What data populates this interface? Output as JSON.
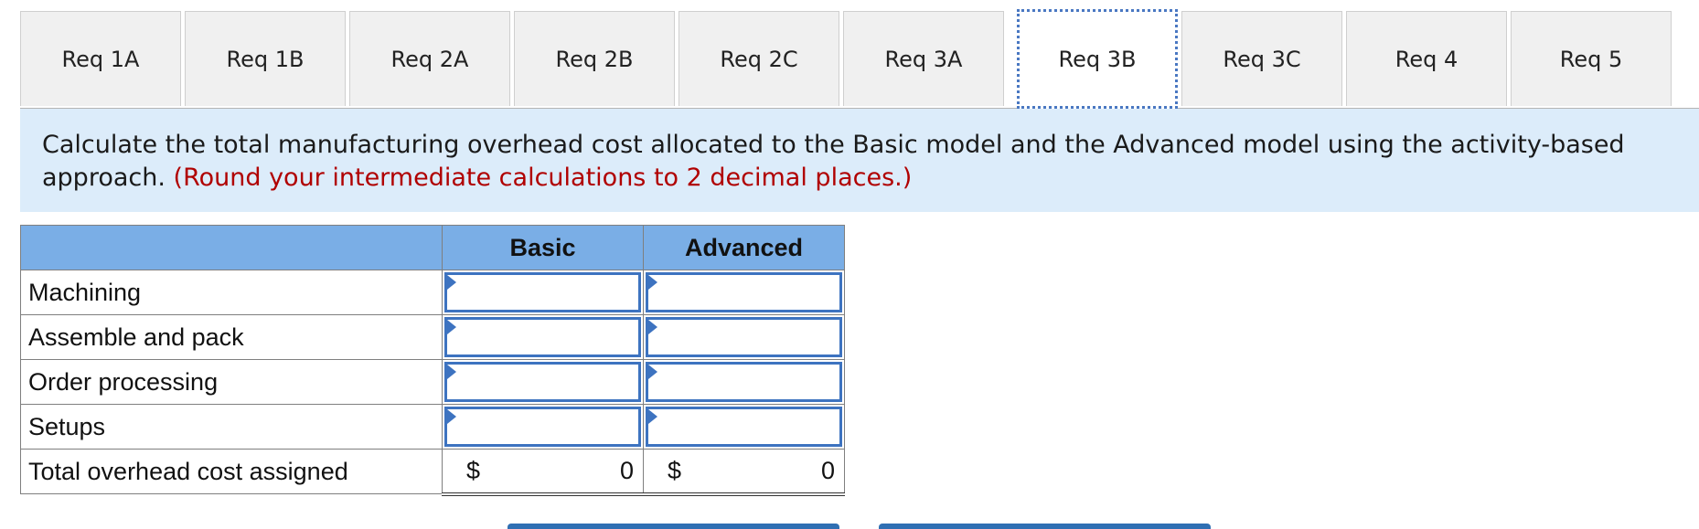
{
  "tabs": [
    {
      "label": "Req 1A"
    },
    {
      "label": "Req 1B"
    },
    {
      "label": "Req 2A"
    },
    {
      "label": "Req 2B"
    },
    {
      "label": "Req 2C"
    },
    {
      "label": "Req 3A"
    },
    {
      "label": "Req 3B"
    },
    {
      "label": "Req 3C"
    },
    {
      "label": "Req 4"
    },
    {
      "label": "Req 5"
    }
  ],
  "active_tab": "Req 3B",
  "instructions": {
    "text": "Calculate the total manufacturing overhead cost allocated to the Basic model and the Advanced model using the activity-based approach.",
    "note": "(Round your intermediate calculations to 2 decimal places.)"
  },
  "table": {
    "columns": [
      "Basic",
      "Advanced"
    ],
    "rows": [
      {
        "label": "Machining",
        "basic": "",
        "advanced": ""
      },
      {
        "label": "Assemble and pack",
        "basic": "",
        "advanced": ""
      },
      {
        "label": "Order processing",
        "basic": "",
        "advanced": ""
      },
      {
        "label": "Setups",
        "basic": "",
        "advanced": ""
      }
    ],
    "total": {
      "label": "Total overhead cost assigned",
      "currency": "$",
      "basic": "0",
      "advanced": "0"
    }
  },
  "colors": {
    "header_bg": "#7aaee6",
    "instruction_bg": "#dcecfa",
    "input_border": "#3d73c0",
    "note": "#b00000"
  }
}
